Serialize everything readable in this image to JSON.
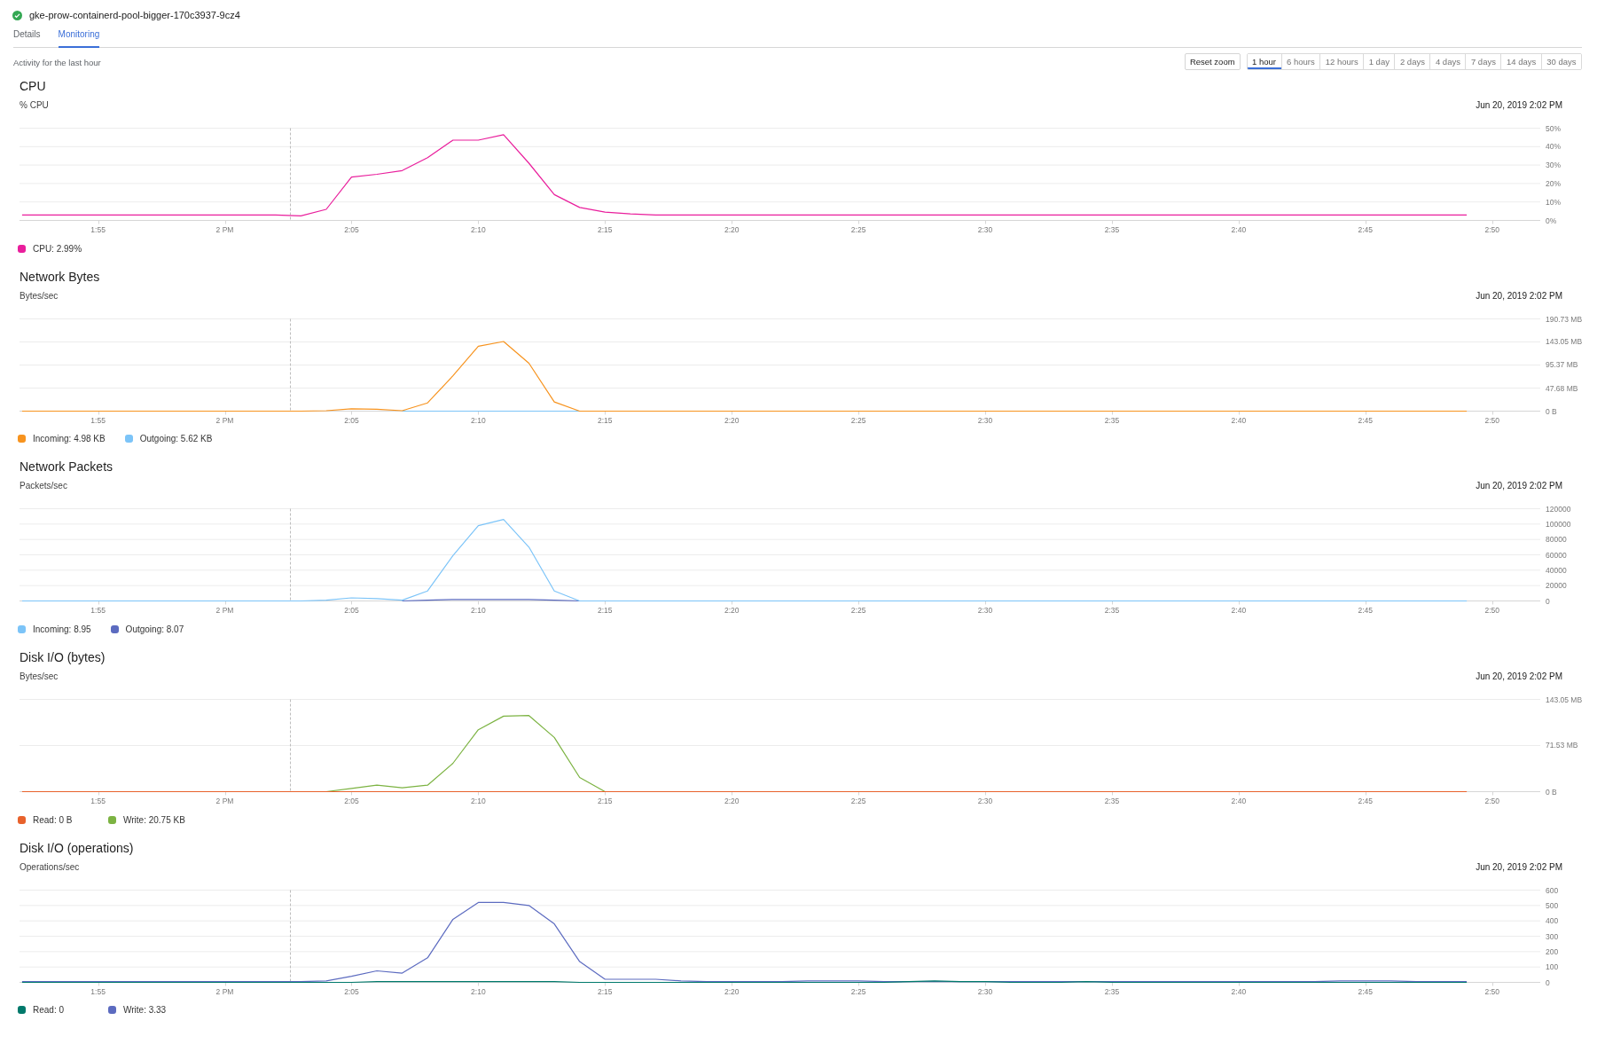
{
  "header": {
    "title": "gke-prow-containerd-pool-bigger-170c3937-9cz4"
  },
  "tabs": [
    {
      "label": "Details",
      "selected": false
    },
    {
      "label": "Monitoring",
      "selected": true
    }
  ],
  "activity_label": "Activity for the last hour",
  "reset_zoom_button": "Reset zoom",
  "time_ranges": [
    {
      "label": "1 hour",
      "selected": true
    },
    {
      "label": "6 hours",
      "selected": false
    },
    {
      "label": "12 hours",
      "selected": false
    },
    {
      "label": "1 day",
      "selected": false
    },
    {
      "label": "2 days",
      "selected": false
    },
    {
      "label": "4 days",
      "selected": false
    },
    {
      "label": "7 days",
      "selected": false
    },
    {
      "label": "14 days",
      "selected": false
    },
    {
      "label": "30 days",
      "selected": false
    }
  ],
  "charts": [
    {
      "title": "CPU",
      "unit": "% CPU",
      "timestamp": "Jun 20, 2019 2:02 PM",
      "chart_data": {
        "type": "line",
        "grid": true,
        "x": [
          "2019-06-20T13:52",
          "2019-06-20T13:53",
          "2019-06-20T13:54",
          "2019-06-20T13:55",
          "2019-06-20T13:56",
          "2019-06-20T13:57",
          "2019-06-20T13:58",
          "2019-06-20T13:59",
          "2019-06-20T14:00",
          "2019-06-20T14:01",
          "2019-06-20T14:02",
          "2019-06-20T14:03",
          "2019-06-20T14:04",
          "2019-06-20T14:05",
          "2019-06-20T14:06",
          "2019-06-20T14:07",
          "2019-06-20T14:08",
          "2019-06-20T14:09",
          "2019-06-20T14:10",
          "2019-06-20T14:11",
          "2019-06-20T14:12",
          "2019-06-20T14:13",
          "2019-06-20T14:14",
          "2019-06-20T14:15",
          "2019-06-20T14:16",
          "2019-06-20T14:17",
          "2019-06-20T14:18",
          "2019-06-20T14:19",
          "2019-06-20T14:20",
          "2019-06-20T14:21",
          "2019-06-20T14:22",
          "2019-06-20T14:23",
          "2019-06-20T14:24",
          "2019-06-20T14:25",
          "2019-06-20T14:26",
          "2019-06-20T14:27",
          "2019-06-20T14:28",
          "2019-06-20T14:29",
          "2019-06-20T14:30",
          "2019-06-20T14:31",
          "2019-06-20T14:32",
          "2019-06-20T14:33",
          "2019-06-20T14:34",
          "2019-06-20T14:35",
          "2019-06-20T14:36",
          "2019-06-20T14:37",
          "2019-06-20T14:38",
          "2019-06-20T14:39",
          "2019-06-20T14:40",
          "2019-06-20T14:41",
          "2019-06-20T14:42",
          "2019-06-20T14:43",
          "2019-06-20T14:44",
          "2019-06-20T14:45",
          "2019-06-20T14:46",
          "2019-06-20T14:47",
          "2019-06-20T14:48",
          "2019-06-20T14:49"
        ],
        "series": [
          {
            "color": "#e91e9c",
            "values": [
              3,
              3,
              3,
              3,
              3,
              3,
              3,
              3,
              3,
              3,
              3,
              2.5,
              6,
              23.5,
              25,
              27,
              34,
              43.5,
              43.5,
              46.5,
              31,
              14,
              7,
              4.5,
              3.5,
              3,
              3,
              3,
              3,
              3,
              3,
              3,
              3,
              3,
              3,
              3,
              3,
              3,
              3,
              3,
              3,
              3,
              3,
              3,
              3,
              3,
              3,
              3,
              3,
              3,
              3,
              3,
              3,
              3,
              3,
              3,
              3,
              3
            ]
          }
        ],
        "xlim": [
          "2019-06-20T13:51:54",
          "2019-06-20T14:51:54"
        ],
        "ylim": [
          0,
          50
        ],
        "xticks": [
          {
            "value": "2019-06-20T13:55",
            "label": "1:55"
          },
          {
            "value": "2019-06-20T14:00",
            "label": "2 PM"
          },
          {
            "value": "2019-06-20T14:05",
            "label": "2:05"
          },
          {
            "value": "2019-06-20T14:10",
            "label": "2:10"
          },
          {
            "value": "2019-06-20T14:15",
            "label": "2:15"
          },
          {
            "value": "2019-06-20T14:20",
            "label": "2:20"
          },
          {
            "value": "2019-06-20T14:25",
            "label": "2:25"
          },
          {
            "value": "2019-06-20T14:30",
            "label": "2:30"
          },
          {
            "value": "2019-06-20T14:35",
            "label": "2:35"
          },
          {
            "value": "2019-06-20T14:40",
            "label": "2:40"
          },
          {
            "value": "2019-06-20T14:45",
            "label": "2:45"
          },
          {
            "value": "2019-06-20T14:50",
            "label": "2:50"
          }
        ],
        "yticks": [
          {
            "value": 0,
            "label": "0%"
          },
          {
            "value": 10,
            "label": "10%"
          },
          {
            "value": 20,
            "label": "20%"
          },
          {
            "value": 30,
            "label": "30%"
          },
          {
            "value": 40,
            "label": "40%"
          },
          {
            "value": 50,
            "label": "50%"
          }
        ],
        "ref_lines": [
          {
            "axis": "x",
            "value": "2019-06-20T14:02:34",
            "color": "#bdbdbd",
            "line_style": "dashed"
          }
        ]
      },
      "legend_items": [
        {
          "label": "CPU: 2.99%",
          "color": "#e91e9c"
        }
      ]
    },
    {
      "title": "Network Bytes",
      "unit": "Bytes/sec",
      "timestamp": "Jun 20, 2019 2:02 PM",
      "chart_data": {
        "type": "line",
        "grid": true,
        "x": [
          "2019-06-20T13:52",
          "2019-06-20T13:53",
          "2019-06-20T13:54",
          "2019-06-20T13:55",
          "2019-06-20T13:56",
          "2019-06-20T13:57",
          "2019-06-20T13:58",
          "2019-06-20T13:59",
          "2019-06-20T14:00",
          "2019-06-20T14:01",
          "2019-06-20T14:02",
          "2019-06-20T14:03",
          "2019-06-20T14:04",
          "2019-06-20T14:05",
          "2019-06-20T14:06",
          "2019-06-20T14:07",
          "2019-06-20T14:08",
          "2019-06-20T14:09",
          "2019-06-20T14:10",
          "2019-06-20T14:11",
          "2019-06-20T14:12",
          "2019-06-20T14:13",
          "2019-06-20T14:14",
          "2019-06-20T14:15",
          "2019-06-20T14:16",
          "2019-06-20T14:17",
          "2019-06-20T14:18",
          "2019-06-20T14:19",
          "2019-06-20T14:20",
          "2019-06-20T14:21",
          "2019-06-20T14:22",
          "2019-06-20T14:23",
          "2019-06-20T14:24",
          "2019-06-20T14:25",
          "2019-06-20T14:26",
          "2019-06-20T14:27",
          "2019-06-20T14:28",
          "2019-06-20T14:29",
          "2019-06-20T14:30",
          "2019-06-20T14:31",
          "2019-06-20T14:32",
          "2019-06-20T14:33",
          "2019-06-20T14:34",
          "2019-06-20T14:35",
          "2019-06-20T14:36",
          "2019-06-20T14:37",
          "2019-06-20T14:38",
          "2019-06-20T14:39",
          "2019-06-20T14:40",
          "2019-06-20T14:41",
          "2019-06-20T14:42",
          "2019-06-20T14:43",
          "2019-06-20T14:44",
          "2019-06-20T14:45",
          "2019-06-20T14:46",
          "2019-06-20T14:47",
          "2019-06-20T14:48",
          "2019-06-20T14:49"
        ],
        "series": [
          {
            "color": "#f7931e",
            "values": [
              0,
              0,
              0,
              0,
              0,
              0,
              0,
              0,
              0,
              0,
              0,
              0,
              1,
              5,
              4,
              1,
              17,
              73,
              134,
              144,
              99,
              19,
              0,
              0,
              0,
              0,
              0,
              0,
              0,
              0,
              0,
              0,
              0,
              0,
              0,
              0,
              0,
              0,
              0,
              0,
              0,
              0,
              0,
              0,
              0,
              0,
              0,
              0,
              0,
              0,
              0,
              0,
              0,
              0,
              0,
              0,
              0,
              0
            ]
          },
          {
            "color": "#7cc4f8",
            "values": [
              null,
              null,
              null,
              null,
              null,
              null,
              null,
              null,
              null,
              null,
              null,
              null,
              null,
              null,
              null,
              0,
              0,
              0,
              0,
              0,
              0,
              0,
              0,
              null,
              null,
              null,
              null,
              null,
              null,
              null,
              null,
              null,
              null,
              null,
              null,
              null,
              null,
              null,
              null,
              null,
              null,
              null,
              null,
              null,
              null,
              null,
              null,
              null,
              null,
              null,
              null,
              null,
              null,
              null,
              null,
              null,
              null,
              null
            ]
          }
        ],
        "xlim": [
          "2019-06-20T13:51:54",
          "2019-06-20T14:51:54"
        ],
        "ylim": [
          0,
          190.73
        ],
        "xticks": [
          {
            "value": "2019-06-20T13:55",
            "label": "1:55"
          },
          {
            "value": "2019-06-20T14:00",
            "label": "2 PM"
          },
          {
            "value": "2019-06-20T14:05",
            "label": "2:05"
          },
          {
            "value": "2019-06-20T14:10",
            "label": "2:10"
          },
          {
            "value": "2019-06-20T14:15",
            "label": "2:15"
          },
          {
            "value": "2019-06-20T14:20",
            "label": "2:20"
          },
          {
            "value": "2019-06-20T14:25",
            "label": "2:25"
          },
          {
            "value": "2019-06-20T14:30",
            "label": "2:30"
          },
          {
            "value": "2019-06-20T14:35",
            "label": "2:35"
          },
          {
            "value": "2019-06-20T14:40",
            "label": "2:40"
          },
          {
            "value": "2019-06-20T14:45",
            "label": "2:45"
          },
          {
            "value": "2019-06-20T14:50",
            "label": "2:50"
          }
        ],
        "yticks": [
          {
            "value": 0,
            "label": "0 B"
          },
          {
            "value": 47.68,
            "label": "47.68 MB"
          },
          {
            "value": 95.37,
            "label": "95.37 MB"
          },
          {
            "value": 143.05,
            "label": "143.05 MB"
          },
          {
            "value": 190.73,
            "label": "190.73 MB"
          }
        ],
        "ref_lines": [
          {
            "axis": "x",
            "value": "2019-06-20T14:02:34",
            "color": "#bdbdbd",
            "line_style": "dashed"
          }
        ]
      },
      "legend_items": [
        {
          "label": "Incoming: 4.98 KB",
          "color": "#f7931e"
        },
        {
          "label": "Outgoing: 5.62 KB",
          "color": "#7cc4f8"
        }
      ]
    },
    {
      "title": "Network Packets",
      "unit": "Packets/sec",
      "timestamp": "Jun 20, 2019 2:02 PM",
      "chart_data": {
        "type": "line",
        "grid": true,
        "x": [
          "2019-06-20T13:52",
          "2019-06-20T13:53",
          "2019-06-20T13:54",
          "2019-06-20T13:55",
          "2019-06-20T13:56",
          "2019-06-20T13:57",
          "2019-06-20T13:58",
          "2019-06-20T13:59",
          "2019-06-20T14:00",
          "2019-06-20T14:01",
          "2019-06-20T14:02",
          "2019-06-20T14:03",
          "2019-06-20T14:04",
          "2019-06-20T14:05",
          "2019-06-20T14:06",
          "2019-06-20T14:07",
          "2019-06-20T14:08",
          "2019-06-20T14:09",
          "2019-06-20T14:10",
          "2019-06-20T14:11",
          "2019-06-20T14:12",
          "2019-06-20T14:13",
          "2019-06-20T14:14",
          "2019-06-20T14:15",
          "2019-06-20T14:16",
          "2019-06-20T14:17",
          "2019-06-20T14:18",
          "2019-06-20T14:19",
          "2019-06-20T14:20",
          "2019-06-20T14:21",
          "2019-06-20T14:22",
          "2019-06-20T14:23",
          "2019-06-20T14:24",
          "2019-06-20T14:25",
          "2019-06-20T14:26",
          "2019-06-20T14:27",
          "2019-06-20T14:28",
          "2019-06-20T14:29",
          "2019-06-20T14:30",
          "2019-06-20T14:31",
          "2019-06-20T14:32",
          "2019-06-20T14:33",
          "2019-06-20T14:34",
          "2019-06-20T14:35",
          "2019-06-20T14:36",
          "2019-06-20T14:37",
          "2019-06-20T14:38",
          "2019-06-20T14:39",
          "2019-06-20T14:40",
          "2019-06-20T14:41",
          "2019-06-20T14:42",
          "2019-06-20T14:43",
          "2019-06-20T14:44",
          "2019-06-20T14:45",
          "2019-06-20T14:46",
          "2019-06-20T14:47",
          "2019-06-20T14:48",
          "2019-06-20T14:49"
        ],
        "series": [
          {
            "color": "#7cc4f8",
            "values": [
              0,
              0,
              0,
              0,
              0,
              0,
              0,
              0,
              0,
              0,
              0,
              0,
              1000,
              4000,
              3000,
              1000,
              13000,
              59000,
              98000,
              106000,
              70000,
              13000,
              0,
              0,
              0,
              0,
              0,
              0,
              0,
              0,
              0,
              0,
              0,
              0,
              0,
              0,
              0,
              0,
              0,
              0,
              0,
              0,
              0,
              0,
              0,
              0,
              0,
              0,
              0,
              0,
              0,
              0,
              0,
              0,
              0,
              0,
              0,
              0
            ]
          },
          {
            "color": "#5c6bc0",
            "values": [
              null,
              null,
              null,
              null,
              null,
              null,
              null,
              null,
              null,
              null,
              null,
              null,
              null,
              null,
              null,
              0,
              1000,
              2000,
              2000,
              2000,
              2000,
              1000,
              0,
              null,
              null,
              null,
              null,
              null,
              null,
              null,
              null,
              null,
              null,
              null,
              null,
              null,
              null,
              null,
              null,
              null,
              null,
              null,
              null,
              null,
              null,
              null,
              null,
              null,
              null,
              null,
              null,
              null,
              null,
              null,
              null,
              null,
              null,
              null
            ]
          }
        ],
        "xlim": [
          "2019-06-20T13:51:54",
          "2019-06-20T14:51:54"
        ],
        "ylim": [
          0,
          120000
        ],
        "xticks": [
          {
            "value": "2019-06-20T13:55",
            "label": "1:55"
          },
          {
            "value": "2019-06-20T14:00",
            "label": "2 PM"
          },
          {
            "value": "2019-06-20T14:05",
            "label": "2:05"
          },
          {
            "value": "2019-06-20T14:10",
            "label": "2:10"
          },
          {
            "value": "2019-06-20T14:15",
            "label": "2:15"
          },
          {
            "value": "2019-06-20T14:20",
            "label": "2:20"
          },
          {
            "value": "2019-06-20T14:25",
            "label": "2:25"
          },
          {
            "value": "2019-06-20T14:30",
            "label": "2:30"
          },
          {
            "value": "2019-06-20T14:35",
            "label": "2:35"
          },
          {
            "value": "2019-06-20T14:40",
            "label": "2:40"
          },
          {
            "value": "2019-06-20T14:45",
            "label": "2:45"
          },
          {
            "value": "2019-06-20T14:50",
            "label": "2:50"
          }
        ],
        "yticks": [
          0,
          20000,
          40000,
          60000,
          80000,
          100000,
          120000
        ],
        "ref_lines": [
          {
            "axis": "x",
            "value": "2019-06-20T14:02:34",
            "color": "#bdbdbd",
            "line_style": "dashed"
          }
        ]
      },
      "legend_items": [
        {
          "label": "Incoming: 8.95",
          "color": "#7cc4f8"
        },
        {
          "label": "Outgoing: 8.07",
          "color": "#5c6bc0"
        }
      ]
    },
    {
      "title": "Disk I/O (bytes)",
      "unit": "Bytes/sec",
      "timestamp": "Jun 20, 2019 2:02 PM",
      "chart_data": {
        "type": "line",
        "grid": true,
        "x": [
          "2019-06-20T13:52",
          "2019-06-20T13:53",
          "2019-06-20T13:54",
          "2019-06-20T13:55",
          "2019-06-20T13:56",
          "2019-06-20T13:57",
          "2019-06-20T13:58",
          "2019-06-20T13:59",
          "2019-06-20T14:00",
          "2019-06-20T14:01",
          "2019-06-20T14:02",
          "2019-06-20T14:03",
          "2019-06-20T14:04",
          "2019-06-20T14:05",
          "2019-06-20T14:06",
          "2019-06-20T14:07",
          "2019-06-20T14:08",
          "2019-06-20T14:09",
          "2019-06-20T14:10",
          "2019-06-20T14:11",
          "2019-06-20T14:12",
          "2019-06-20T14:13",
          "2019-06-20T14:14",
          "2019-06-20T14:15",
          "2019-06-20T14:16",
          "2019-06-20T14:17",
          "2019-06-20T14:18",
          "2019-06-20T14:19",
          "2019-06-20T14:20",
          "2019-06-20T14:21",
          "2019-06-20T14:22",
          "2019-06-20T14:23",
          "2019-06-20T14:24",
          "2019-06-20T14:25",
          "2019-06-20T14:26",
          "2019-06-20T14:27",
          "2019-06-20T14:28",
          "2019-06-20T14:29",
          "2019-06-20T14:30",
          "2019-06-20T14:31",
          "2019-06-20T14:32",
          "2019-06-20T14:33",
          "2019-06-20T14:34",
          "2019-06-20T14:35",
          "2019-06-20T14:36",
          "2019-06-20T14:37",
          "2019-06-20T14:38",
          "2019-06-20T14:39",
          "2019-06-20T14:40",
          "2019-06-20T14:41",
          "2019-06-20T14:42",
          "2019-06-20T14:43",
          "2019-06-20T14:44",
          "2019-06-20T14:45",
          "2019-06-20T14:46",
          "2019-06-20T14:47",
          "2019-06-20T14:48",
          "2019-06-20T14:49"
        ],
        "series": [
          {
            "color": "#e8622c",
            "values": [
              0,
              0,
              0,
              0,
              0,
              0,
              0,
              0,
              0,
              0,
              0,
              0,
              0,
              0,
              0,
              0,
              0,
              0,
              0,
              0,
              0,
              0,
              0,
              0,
              0,
              0,
              0,
              0,
              0,
              0,
              0,
              0,
              0,
              0,
              0,
              0,
              0,
              0,
              0,
              0,
              0,
              0,
              0,
              0,
              0,
              0,
              0,
              0,
              0,
              0,
              0,
              0,
              0,
              0,
              0,
              0,
              0,
              0
            ]
          },
          {
            "color": "#7cb342",
            "values": [
              null,
              null,
              null,
              null,
              null,
              null,
              null,
              null,
              null,
              null,
              null,
              null,
              0,
              5,
              10,
              6,
              10,
              44,
              96,
              117,
              118,
              84,
              22,
              0,
              null,
              null,
              null,
              null,
              null,
              null,
              null,
              null,
              null,
              null,
              null,
              null,
              null,
              null,
              null,
              null,
              null,
              null,
              null,
              null,
              null,
              null,
              null,
              null,
              null,
              null,
              null,
              null,
              null,
              null,
              null,
              null,
              null,
              null
            ]
          }
        ],
        "xlim": [
          "2019-06-20T13:51:54",
          "2019-06-20T14:51:54"
        ],
        "ylim": [
          0,
          143.05
        ],
        "xticks": [
          {
            "value": "2019-06-20T13:55",
            "label": "1:55"
          },
          {
            "value": "2019-06-20T14:00",
            "label": "2 PM"
          },
          {
            "value": "2019-06-20T14:05",
            "label": "2:05"
          },
          {
            "value": "2019-06-20T14:10",
            "label": "2:10"
          },
          {
            "value": "2019-06-20T14:15",
            "label": "2:15"
          },
          {
            "value": "2019-06-20T14:20",
            "label": "2:20"
          },
          {
            "value": "2019-06-20T14:25",
            "label": "2:25"
          },
          {
            "value": "2019-06-20T14:30",
            "label": "2:30"
          },
          {
            "value": "2019-06-20T14:35",
            "label": "2:35"
          },
          {
            "value": "2019-06-20T14:40",
            "label": "2:40"
          },
          {
            "value": "2019-06-20T14:45",
            "label": "2:45"
          },
          {
            "value": "2019-06-20T14:50",
            "label": "2:50"
          }
        ],
        "yticks": [
          {
            "value": 0,
            "label": "0 B"
          },
          {
            "value": 71.53,
            "label": "71.53 MB"
          },
          {
            "value": 143.05,
            "label": "143.05 MB"
          }
        ],
        "ref_lines": [
          {
            "axis": "x",
            "value": "2019-06-20T14:02:34",
            "color": "#bdbdbd",
            "line_style": "dashed"
          }
        ]
      },
      "legend_items": [
        {
          "label": "Read: 0 B",
          "color": "#e8622c"
        },
        {
          "label": "Write: 20.75 KB",
          "color": "#7cb342"
        }
      ]
    },
    {
      "title": "Disk I/O (operations)",
      "unit": "Operations/sec",
      "timestamp": "Jun 20, 2019 2:02 PM",
      "chart_data": {
        "type": "line",
        "grid": true,
        "x": [
          "2019-06-20T13:52",
          "2019-06-20T13:53",
          "2019-06-20T13:54",
          "2019-06-20T13:55",
          "2019-06-20T13:56",
          "2019-06-20T13:57",
          "2019-06-20T13:58",
          "2019-06-20T13:59",
          "2019-06-20T14:00",
          "2019-06-20T14:01",
          "2019-06-20T14:02",
          "2019-06-20T14:03",
          "2019-06-20T14:04",
          "2019-06-20T14:05",
          "2019-06-20T14:06",
          "2019-06-20T14:07",
          "2019-06-20T14:08",
          "2019-06-20T14:09",
          "2019-06-20T14:10",
          "2019-06-20T14:11",
          "2019-06-20T14:12",
          "2019-06-20T14:13",
          "2019-06-20T14:14",
          "2019-06-20T14:15",
          "2019-06-20T14:16",
          "2019-06-20T14:17",
          "2019-06-20T14:18",
          "2019-06-20T14:19",
          "2019-06-20T14:20",
          "2019-06-20T14:21",
          "2019-06-20T14:22",
          "2019-06-20T14:23",
          "2019-06-20T14:24",
          "2019-06-20T14:25",
          "2019-06-20T14:26",
          "2019-06-20T14:27",
          "2019-06-20T14:28",
          "2019-06-20T14:29",
          "2019-06-20T14:30",
          "2019-06-20T14:31",
          "2019-06-20T14:32",
          "2019-06-20T14:33",
          "2019-06-20T14:34",
          "2019-06-20T14:35",
          "2019-06-20T14:36",
          "2019-06-20T14:37",
          "2019-06-20T14:38",
          "2019-06-20T14:39",
          "2019-06-20T14:40",
          "2019-06-20T14:41",
          "2019-06-20T14:42",
          "2019-06-20T14:43",
          "2019-06-20T14:44",
          "2019-06-20T14:45",
          "2019-06-20T14:46",
          "2019-06-20T14:47",
          "2019-06-20T14:48",
          "2019-06-20T14:49"
        ],
        "series": [
          {
            "color": "#00796b",
            "values": [
              0,
              0,
              0,
              0,
              0,
              0,
              0,
              0,
              0,
              0,
              0,
              0,
              0,
              0,
              5,
              5,
              5,
              5,
              5,
              5,
              5,
              5,
              0,
              0,
              0,
              0,
              0,
              0,
              0,
              0,
              0,
              0,
              0,
              0,
              0,
              5,
              10,
              5,
              5,
              0,
              0,
              0,
              5,
              0,
              0,
              0,
              0,
              0,
              0,
              0,
              0,
              0,
              0,
              0,
              0,
              0,
              0,
              0
            ]
          },
          {
            "color": "#5c6bc0",
            "values": [
              5,
              5,
              5,
              5,
              5,
              5,
              5,
              5,
              5,
              5,
              5,
              5,
              10,
              40,
              75,
              60,
              160,
              410,
              520,
              520,
              500,
              380,
              135,
              20,
              20,
              20,
              10,
              5,
              5,
              5,
              5,
              10,
              10,
              10,
              5,
              5,
              5,
              5,
              5,
              5,
              5,
              5,
              5,
              5,
              5,
              5,
              5,
              5,
              5,
              5,
              5,
              5,
              10,
              10,
              10,
              5,
              5,
              5
            ]
          }
        ],
        "xlim": [
          "2019-06-20T13:51:54",
          "2019-06-20T14:51:54"
        ],
        "ylim": [
          0,
          600
        ],
        "xticks": [
          {
            "value": "2019-06-20T13:55",
            "label": "1:55"
          },
          {
            "value": "2019-06-20T14:00",
            "label": "2 PM"
          },
          {
            "value": "2019-06-20T14:05",
            "label": "2:05"
          },
          {
            "value": "2019-06-20T14:10",
            "label": "2:10"
          },
          {
            "value": "2019-06-20T14:15",
            "label": "2:15"
          },
          {
            "value": "2019-06-20T14:20",
            "label": "2:20"
          },
          {
            "value": "2019-06-20T14:25",
            "label": "2:25"
          },
          {
            "value": "2019-06-20T14:30",
            "label": "2:30"
          },
          {
            "value": "2019-06-20T14:35",
            "label": "2:35"
          },
          {
            "value": "2019-06-20T14:40",
            "label": "2:40"
          },
          {
            "value": "2019-06-20T14:45",
            "label": "2:45"
          },
          {
            "value": "2019-06-20T14:50",
            "label": "2:50"
          }
        ],
        "yticks": [
          0,
          100,
          200,
          300,
          400,
          500,
          600
        ],
        "ref_lines": [
          {
            "axis": "x",
            "value": "2019-06-20T14:02:34",
            "color": "#bdbdbd",
            "line_style": "dashed"
          }
        ]
      },
      "legend_items": [
        {
          "label": "Read: 0",
          "color": "#00796b"
        },
        {
          "label": "Write: 3.33",
          "color": "#5c6bc0"
        }
      ]
    }
  ]
}
